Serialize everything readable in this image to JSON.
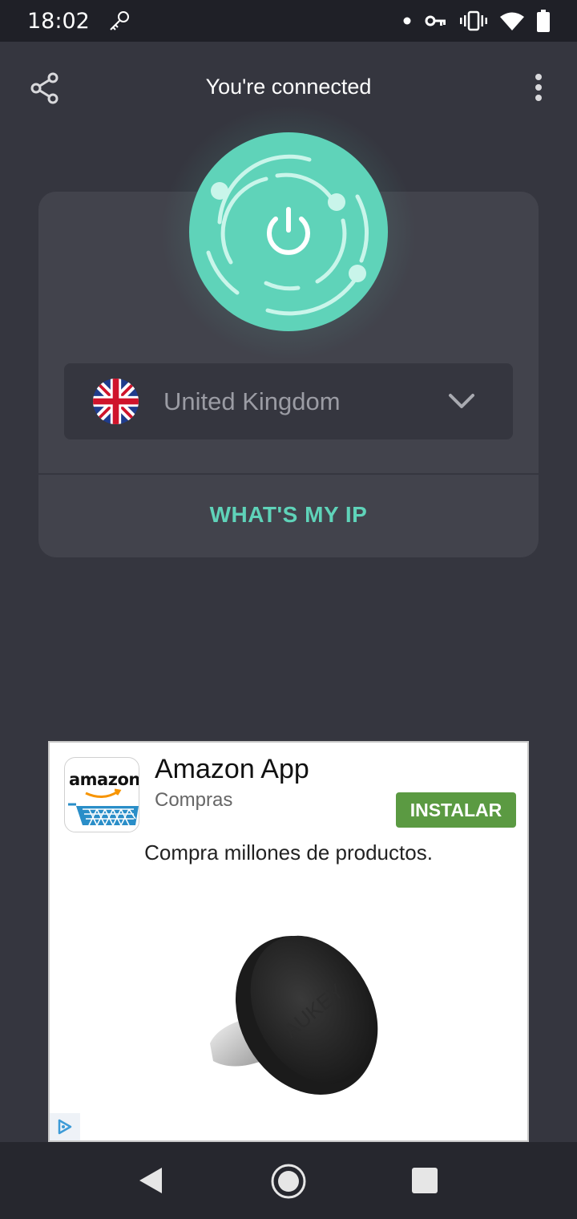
{
  "status_bar": {
    "time": "18:02",
    "icons": [
      "key-icon",
      "notification-dot-icon",
      "vpn-key-icon",
      "vibrate-icon",
      "wifi-icon",
      "battery-icon"
    ]
  },
  "header": {
    "title": "You're connected",
    "share_icon": "share-icon",
    "menu_icon": "more-vert-icon"
  },
  "vpn": {
    "power_icon": "power-icon",
    "state_color": "#5fd3b9",
    "country": {
      "name": "United Kingdom",
      "flag_icon": "uk-flag-icon",
      "dropdown_icon": "chevron-down-icon"
    },
    "whats_my_ip_label": "WHAT'S MY IP"
  },
  "ad": {
    "app_name": "Amazon App",
    "category": "Compras",
    "install_label": "INSTALAR",
    "install_color": "#5b9a42",
    "description": "Compra millones de productos.",
    "icon_text": "amazon",
    "product_brand": "AUKEY",
    "product_image": "magnetic-car-mount-image",
    "adchoices_icon": "adchoices-icon"
  },
  "nav_bar": {
    "back_icon": "back-triangle-icon",
    "home_icon": "home-circle-icon",
    "recents_icon": "recents-square-icon"
  }
}
